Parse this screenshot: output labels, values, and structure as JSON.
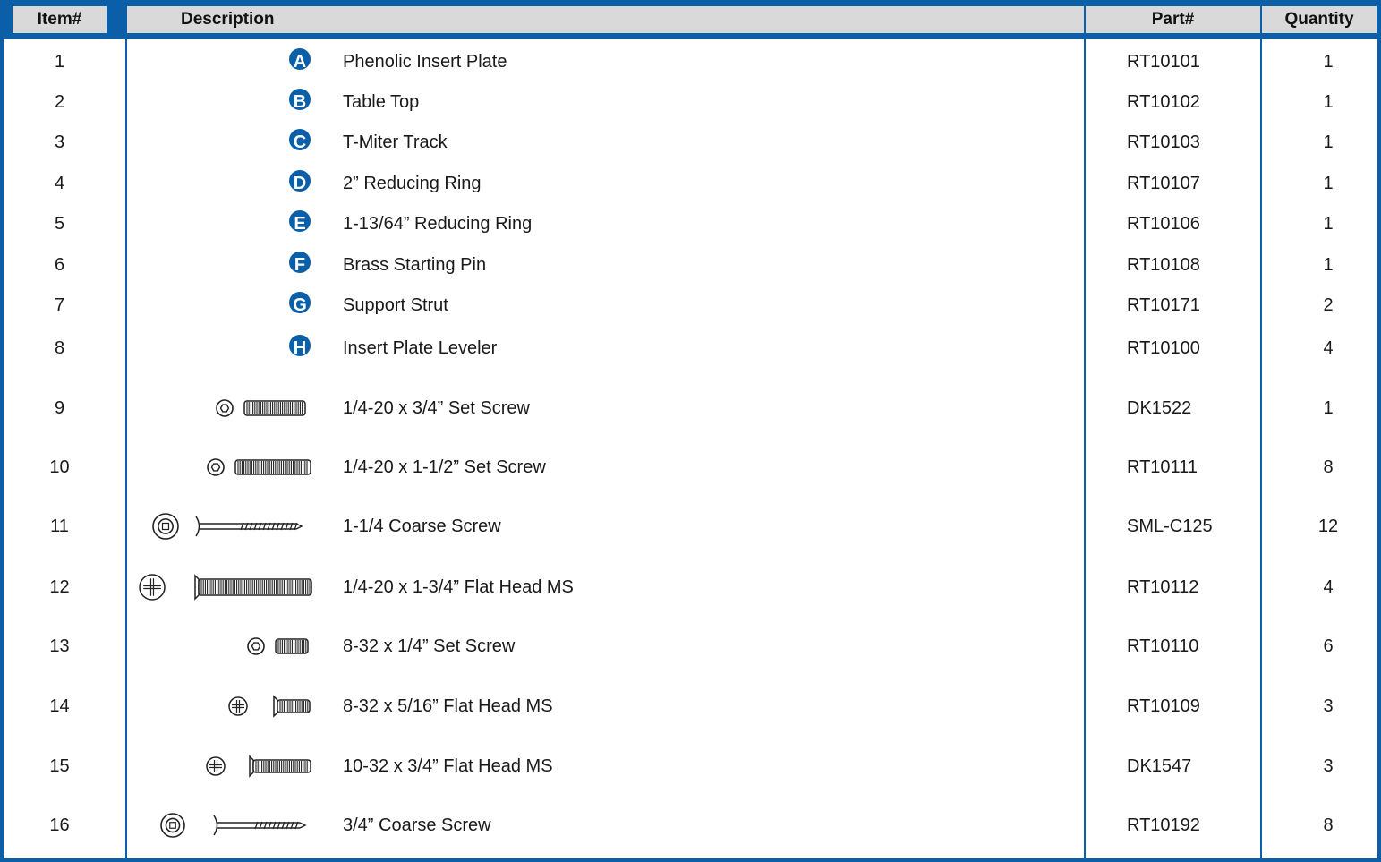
{
  "header": {
    "item": "Item#",
    "description": "Description",
    "part": "Part#",
    "quantity": "Quantity"
  },
  "colors": {
    "accent": "#0a5fa8",
    "header_bg": "#d9d9d9"
  },
  "rows": [
    {
      "item": "1",
      "badge": "A",
      "description": "Phenolic Insert Plate",
      "part": "RT10101",
      "qty": "1"
    },
    {
      "item": "2",
      "badge": "B",
      "description": "Table Top",
      "part": "RT10102",
      "qty": "1"
    },
    {
      "item": "3",
      "badge": "C",
      "description": "T-Miter Track",
      "part": "RT10103",
      "qty": "1"
    },
    {
      "item": "4",
      "badge": "D",
      "description": "2” Reducing Ring",
      "part": "RT10107",
      "qty": "1"
    },
    {
      "item": "5",
      "badge": "E",
      "description": "1-13/64” Reducing Ring",
      "part": "RT10106",
      "qty": "1"
    },
    {
      "item": "6",
      "badge": "F",
      "description": "Brass Starting Pin",
      "part": "RT10108",
      "qty": "1"
    },
    {
      "item": "7",
      "badge": "G",
      "description": "Support Strut",
      "part": "RT10171",
      "qty": "2"
    },
    {
      "item": "8",
      "badge": "H",
      "description": "Insert Plate Leveler",
      "part": "RT10100",
      "qty": "4"
    },
    {
      "item": "9",
      "icon": "set-screw-icon",
      "description": "1/4-20 x 3/4” Set Screw",
      "part": "DK1522",
      "qty": "1"
    },
    {
      "item": "10",
      "icon": "set-screw-long-icon",
      "description": "1/4-20 x 1-1/2” Set Screw",
      "part": "RT10111",
      "qty": "8"
    },
    {
      "item": "11",
      "icon": "coarse-screw-icon",
      "description": "1-1/4 Coarse Screw",
      "part": "SML-C125",
      "qty": "12"
    },
    {
      "item": "12",
      "icon": "flat-head-screw-large-icon",
      "description": "1/4-20 x 1-3/4” Flat Head MS",
      "part": "RT10112",
      "qty": "4"
    },
    {
      "item": "13",
      "icon": "set-screw-short-icon",
      "description": "8-32 x 1/4” Set Screw",
      "part": "RT10110",
      "qty": "6"
    },
    {
      "item": "14",
      "icon": "flat-head-screw-short-icon",
      "description": "8-32 x 5/16” Flat Head MS",
      "part": "RT10109",
      "qty": "3"
    },
    {
      "item": "15",
      "icon": "flat-head-screw-icon",
      "description": "10-32 x 3/4” Flat Head MS",
      "part": "DK1547",
      "qty": "3"
    },
    {
      "item": "16",
      "icon": "coarse-screw-short-icon",
      "description": "3/4” Coarse Screw",
      "part": "RT10192",
      "qty": "8"
    }
  ]
}
